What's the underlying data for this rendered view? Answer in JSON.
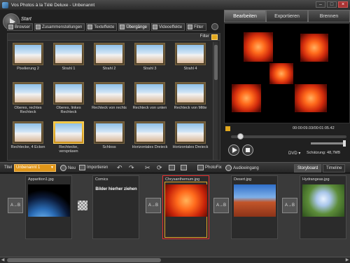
{
  "window": {
    "title": "Vos Photos à la Télé Deluxe - Unbenannt"
  },
  "start": {
    "label": "Start"
  },
  "tabs": [
    {
      "label": "Browser"
    },
    {
      "label": "Zusammenstellungen"
    },
    {
      "label": "Texteffekte"
    },
    {
      "label": "Übergänge"
    },
    {
      "label": "Videoeffekte"
    },
    {
      "label": "Filter"
    }
  ],
  "filter_label": "Filter",
  "effects": [
    {
      "label": "Pixelierung 2"
    },
    {
      "label": "Strahl 1"
    },
    {
      "label": "Strahl 2"
    },
    {
      "label": "Strahl 3"
    },
    {
      "label": "Strahl 4"
    },
    {
      "label": "Oberes, rechtes Rechteck"
    },
    {
      "label": "Oberes, linkes Rechteck"
    },
    {
      "label": "Rechteck von rechts"
    },
    {
      "label": "Rechteck von unten"
    },
    {
      "label": "Rechteck von Mitte"
    },
    {
      "label": "Rechtecke, 4 Ecken"
    },
    {
      "label": "Rechtecke, verspräsen"
    },
    {
      "label": "Schloss"
    },
    {
      "label": "Horizontales Dreieck"
    },
    {
      "label": "Horizontales Dreieck"
    }
  ],
  "selected_effect_index": 11,
  "right_tabs": [
    {
      "label": "Bearbeiten"
    },
    {
      "label": "Exportieren"
    },
    {
      "label": "Brennen"
    }
  ],
  "player": {
    "timecode": "00:00:09.03/00:01:05.42",
    "dvd_label": "DVD",
    "estimate": "Schätzung: 48,7MB",
    "position": 0.08
  },
  "storyboard_toolbar": {
    "titel_label": "Titel",
    "titel_value": "Unbenannt 1",
    "new_label": "Neu",
    "import_label": "Importieren",
    "photofix_label": "PhotoFix",
    "audio_label": "Audioeingang",
    "storyboard_tab": "Storyboard",
    "timeline_tab": "Timeline"
  },
  "storyboard": {
    "slots": [
      {
        "name": "Apparition1.jpg"
      },
      {
        "name": "Comics",
        "text": "Bilder hierher ziehen"
      },
      {
        "name": "Chrysanthemum.jpg"
      },
      {
        "name": "Desert.jpg"
      },
      {
        "name": "Hydrangeas.jpg"
      }
    ],
    "transition_label": "A→B"
  }
}
